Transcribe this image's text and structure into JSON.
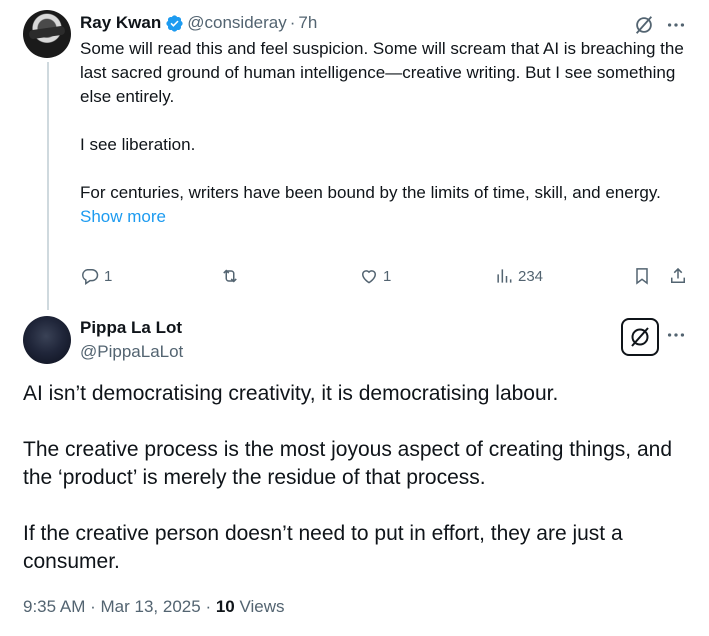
{
  "reply_tweet": {
    "author_name": "Ray Kwan",
    "handle": "@consideray",
    "time": "7h",
    "paragraphs": [
      "Some will read this and feel suspicion. Some will scream that AI is breaching the last sacred ground of human intelligence—creative writing. But I see something else entirely.",
      "",
      "I see liberation.",
      "",
      "For centuries, writers have been bound by the limits of time, skill, and energy."
    ],
    "show_more": "Show more",
    "actions": {
      "replies": "1",
      "reposts": "",
      "likes": "1",
      "views": "234"
    }
  },
  "main_tweet": {
    "author_name": "Pippa La Lot",
    "handle": "@PippaLaLot",
    "paragraphs": [
      "AI isn’t democratising creativity, it is democratising labour.",
      "",
      "The creative process is the most joyous aspect of creating things, and the ‘product’ is merely the residue of that process.",
      "",
      "If the creative person doesn’t need to put in effort, they are just a consumer."
    ],
    "time": "9:35 AM",
    "date": "Mar 13, 2025",
    "views_count": "10",
    "views_label": "Views"
  },
  "colors": {
    "accent": "#1d9bf0",
    "secondary_text": "#536471",
    "primary_text": "#0f1419",
    "thread_line": "#cfd9de"
  },
  "icons": [
    "verified-badge-icon",
    "grok-icon",
    "more-icon",
    "reply-icon",
    "repost-icon",
    "like-icon",
    "views-icon",
    "bookmark-icon",
    "share-icon"
  ]
}
